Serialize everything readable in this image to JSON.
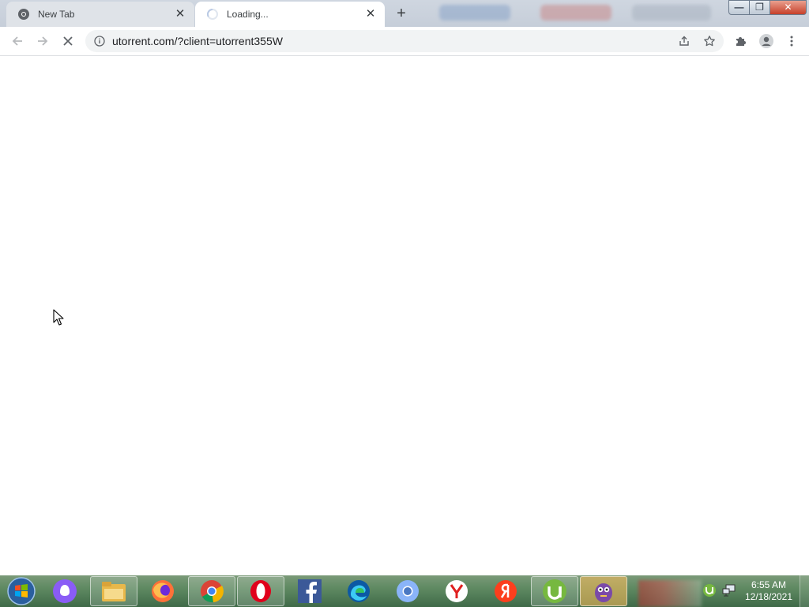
{
  "browser": {
    "tabs": [
      {
        "label": "New Tab",
        "icon": "chrome-icon",
        "active": false
      },
      {
        "label": "Loading...",
        "icon": "loading-spinner-icon",
        "active": true
      }
    ],
    "new_tab_symbol": "+",
    "close_symbol": "✕",
    "address": "utorrent.com/?client=utorrent355W",
    "window_controls": {
      "minimize": "—",
      "maximize": "❐",
      "close": "✕"
    }
  },
  "taskbar": {
    "apps": [
      {
        "name": "start-button"
      },
      {
        "name": "alice-assistant-icon"
      },
      {
        "name": "file-explorer-icon"
      },
      {
        "name": "firefox-icon"
      },
      {
        "name": "chrome-icon"
      },
      {
        "name": "opera-icon"
      },
      {
        "name": "facebook-icon"
      },
      {
        "name": "edge-icon"
      },
      {
        "name": "chromium-icon"
      },
      {
        "name": "yandex-browser-icon"
      },
      {
        "name": "yandex-icon"
      },
      {
        "name": "utorrent-icon"
      },
      {
        "name": "game-icon"
      }
    ],
    "clock": {
      "time": "6:55 AM",
      "date": "12/18/2021"
    }
  },
  "colors": {
    "accent_blue": "#1a73e8",
    "taskbar_green": "#5f8a62",
    "utorrent_green": "#76b83f"
  }
}
